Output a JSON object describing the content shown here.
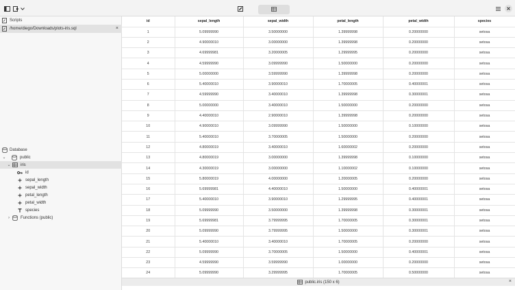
{
  "colors": {
    "toolbar_bg": "#f3f3f3",
    "sidebar_bg": "#f7f7f7",
    "selection_bg": "#e2e2e2"
  },
  "scripts": {
    "header": "Scripts",
    "items": [
      {
        "path": "/home/diego/Downloads/plots-iris.sql",
        "close": "×"
      }
    ]
  },
  "database": {
    "header": "Database",
    "schema": "public",
    "table": "iris",
    "columns": [
      "id",
      "sepal_length",
      "sepal_width",
      "petal_length",
      "petal_width",
      "species"
    ],
    "functions": "Functions (public)"
  },
  "grid": {
    "headers": [
      "id",
      "sepal_length",
      "sepal_width",
      "petal_length",
      "petal_width",
      "species"
    ],
    "rows": [
      [
        "1",
        "5.09999990",
        "3.50000000",
        "1.39999998",
        "0.20000000",
        "setosa"
      ],
      [
        "2",
        "4.90000010",
        "3.00000000",
        "1.39999998",
        "0.20000000",
        "setosa"
      ],
      [
        "3",
        "4.69999981",
        "3.20000005",
        "1.29999995",
        "0.20000000",
        "setosa"
      ],
      [
        "4",
        "4.59999990",
        "3.09999990",
        "1.50000000",
        "0.20000000",
        "setosa"
      ],
      [
        "5",
        "5.00000000",
        "3.59999990",
        "1.39999998",
        "0.20000000",
        "setosa"
      ],
      [
        "6",
        "5.40000010",
        "3.90000010",
        "1.70000005",
        "0.40000001",
        "setosa"
      ],
      [
        "7",
        "4.59999990",
        "3.40000010",
        "1.39999998",
        "0.30000001",
        "setosa"
      ],
      [
        "8",
        "5.00000000",
        "3.40000010",
        "1.50000000",
        "0.20000000",
        "setosa"
      ],
      [
        "9",
        "4.40000010",
        "2.90000010",
        "1.39999998",
        "0.20000000",
        "setosa"
      ],
      [
        "10",
        "4.90000010",
        "3.09999990",
        "1.50000000",
        "0.10000000",
        "setosa"
      ],
      [
        "11",
        "5.40000010",
        "3.70000005",
        "1.50000000",
        "0.20000000",
        "setosa"
      ],
      [
        "12",
        "4.80000019",
        "3.40000010",
        "1.60000002",
        "0.20000000",
        "setosa"
      ],
      [
        "13",
        "4.80000019",
        "3.00000000",
        "1.39999998",
        "0.10000000",
        "setosa"
      ],
      [
        "14",
        "4.30000019",
        "3.00000000",
        "1.10000002",
        "0.10000000",
        "setosa"
      ],
      [
        "15",
        "5.80000019",
        "4.00000000",
        "1.20000005",
        "0.20000000",
        "setosa"
      ],
      [
        "16",
        "5.69999981",
        "4.40000010",
        "1.50000000",
        "0.40000001",
        "setosa"
      ],
      [
        "17",
        "5.40000010",
        "3.90000010",
        "1.29999995",
        "0.40000001",
        "setosa"
      ],
      [
        "18",
        "5.09999990",
        "3.50000000",
        "1.39999998",
        "0.30000001",
        "setosa"
      ],
      [
        "19",
        "5.69999981",
        "3.79999995",
        "1.70000005",
        "0.30000001",
        "setosa"
      ],
      [
        "20",
        "5.09999990",
        "3.79999995",
        "1.50000000",
        "0.30000001",
        "setosa"
      ],
      [
        "21",
        "5.40000010",
        "3.40000010",
        "1.70000005",
        "0.20000000",
        "setosa"
      ],
      [
        "22",
        "5.09999990",
        "3.70000005",
        "1.50000000",
        "0.40000001",
        "setosa"
      ],
      [
        "23",
        "4.59999990",
        "3.59999990",
        "1.00000000",
        "0.20000000",
        "setosa"
      ],
      [
        "24",
        "5.09999990",
        "3.29999995",
        "1.70000005",
        "0.50000000",
        "setosa"
      ]
    ]
  },
  "statusbar": {
    "label": "public.iris (150 x 6)",
    "close": "×"
  },
  "icons": {
    "sidebar_toggle": "sidebar-toggle-icon",
    "run": "run-icon",
    "dropdown": "chevron-down-icon",
    "edit": "edit-icon",
    "grid": "grid-icon",
    "menu": "menu-icon",
    "close": "close-icon"
  }
}
